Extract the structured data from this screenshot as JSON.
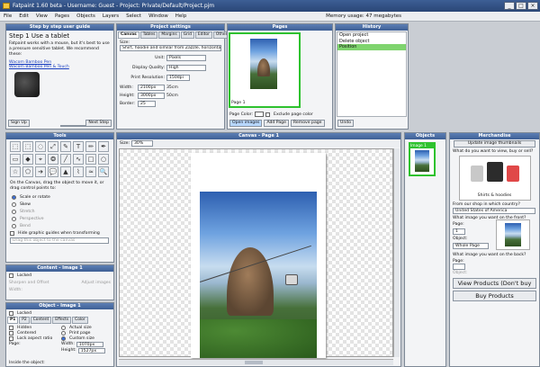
{
  "app": {
    "title": "Fatpaint 1.60 beta - Username: Guest - Project: Private/Default/Project.pjm",
    "memory": "Memory usage: 47 megabytes",
    "window_buttons": [
      "_",
      "□",
      "×"
    ]
  },
  "menu": [
    "File",
    "Edit",
    "View",
    "Pages",
    "Objects",
    "Layers",
    "Select",
    "Window",
    "Help"
  ],
  "guide": {
    "header": "Step by step user guide",
    "title": "Step 1  Use a tablet",
    "body": "Fatpaint works with a mouse, but it's best to use a pressure sensitive tablet. We recommend these:",
    "link1": "Wacom Bamboo Pen",
    "link2": "Wacom Bamboo Pen & Touch",
    "signup": "Sign Up",
    "next": "Next Step"
  },
  "project": {
    "header": "Project settings",
    "tabs": [
      "Canvas",
      "Tables",
      "Margins",
      "Grid",
      "Editor",
      "Other"
    ],
    "size_label": "Size:",
    "size_value": "Shirt, hoodie and similar from Zazzle, horizontal",
    "unit_label": "Unit:",
    "unit_value": "Pixels",
    "quality_label": "Display Quality:",
    "quality_value": "High",
    "res_label": "Print Resolution:",
    "res_value": "150dpi",
    "width_label": "Width:",
    "width_value": "2100px",
    "width_cm": "35cm",
    "height_label": "Height:",
    "height_value": "3000px",
    "height_cm": "50cm",
    "border_label": "Border:",
    "border_value": "25"
  },
  "pages": {
    "header": "Pages",
    "page_label": "Page 1",
    "color_label": "Page Color:",
    "exclude": "Exclude page color",
    "open": "Open images",
    "add": "Add Page",
    "remove": "Remove page"
  },
  "history": {
    "header": "History",
    "items": [
      "Open project",
      "Delete object",
      "Position"
    ],
    "undo": "Undo"
  },
  "tools": {
    "header": "Tools",
    "icons": [
      "select-icon",
      "marquee-icon",
      "lasso-icon",
      "transform-icon",
      "brush-icon",
      "text-icon",
      "pencil-icon",
      "pen-icon",
      "eraser-icon",
      "fill-icon",
      "eyedropper-icon",
      "clone-icon",
      "line-icon",
      "curve-icon",
      "rect-icon",
      "ellipse-icon",
      "star-icon",
      "polygon-icon",
      "arrow-icon",
      "speech-icon",
      "shape-icon",
      "path-icon",
      "smudge-icon",
      "zoom-icon"
    ],
    "glyphs": [
      "⬚",
      "⬚",
      "◌",
      "⤢",
      "✎",
      "T",
      "✏",
      "✒",
      "▭",
      "◆",
      "⌖",
      "❂",
      "╱",
      "∿",
      "□",
      "○",
      "☆",
      "⬠",
      "➔",
      "💬",
      "▲",
      "⌇",
      "≈",
      "🔍"
    ],
    "instructions": "On the Canvas, drag the object to move it, or drag control points to:",
    "options": [
      "Scale or rotate",
      "Skew",
      "Stretch",
      "Perspective",
      "Bend"
    ],
    "hide_guides": "Hide graphic guides when transforming",
    "placeholder": "Drag this object to the canvas"
  },
  "content": {
    "header": "Content - Image 1",
    "locked": "Locked",
    "sharpen": "Sharpen and Offset",
    "sharpen_right": "Adjust images",
    "width_label": "Width:"
  },
  "object": {
    "header": "Object - Image 1",
    "locked": "Locked",
    "tabs": [
      "P1",
      "P2",
      "Content",
      "Effects",
      "Color"
    ],
    "hidden": "Hidden",
    "centered": "Centered",
    "lock_aspect": "Lock aspect ratio",
    "actual": "Actual size",
    "print": "Print page",
    "custom": "Custom size",
    "page_label": "Page:",
    "width_label": "Width:",
    "width_value": "1070px",
    "height_label": "Height:",
    "height_value": "1527px",
    "inside": "Inside the object:"
  },
  "canvas": {
    "header": "Canvas - Page 1",
    "size_label": "Size:",
    "zoom": "30%"
  },
  "objects": {
    "header": "Objects",
    "item": "Image 1"
  },
  "merch": {
    "header": "Merchandise",
    "update": "Update image thumbnails",
    "q1": "What do you want to view, buy or sell?",
    "product": "Shirts & hoodies",
    "q2": "From our shop in which country?",
    "country": "United States of America",
    "q3": "What image you want on the front?",
    "page_label": "Page:",
    "page_value": "1",
    "object_label": "Object:",
    "object_value": "Whole Page",
    "q4": "What image you want on the back?",
    "page2_label": "Page:",
    "object2_label": "Object:",
    "view": "View Products (Don't buy",
    "buy": "Buy Products"
  },
  "colors": {
    "accent": "#3e5f95",
    "selection": "#2ec22e"
  }
}
